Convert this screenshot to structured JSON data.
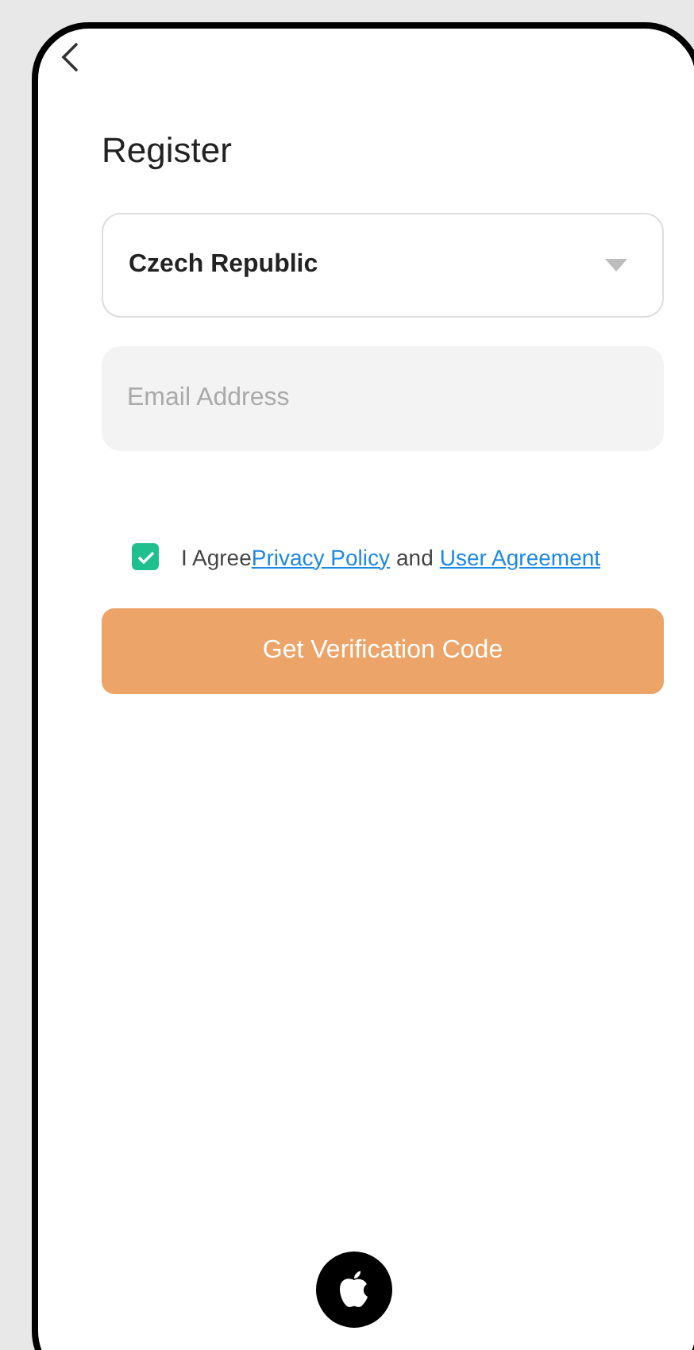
{
  "title": "Register",
  "country_select": {
    "value": "Czech Republic"
  },
  "email_field": {
    "placeholder": "Email Address"
  },
  "agreement": {
    "checked": true,
    "prefix": "I Agree",
    "privacy_link": "Privacy Policy",
    "conjunction": "and",
    "user_agreement_link": "User Agreement"
  },
  "submit_button": {
    "label": "Get Verification Code",
    "disabled": true
  }
}
